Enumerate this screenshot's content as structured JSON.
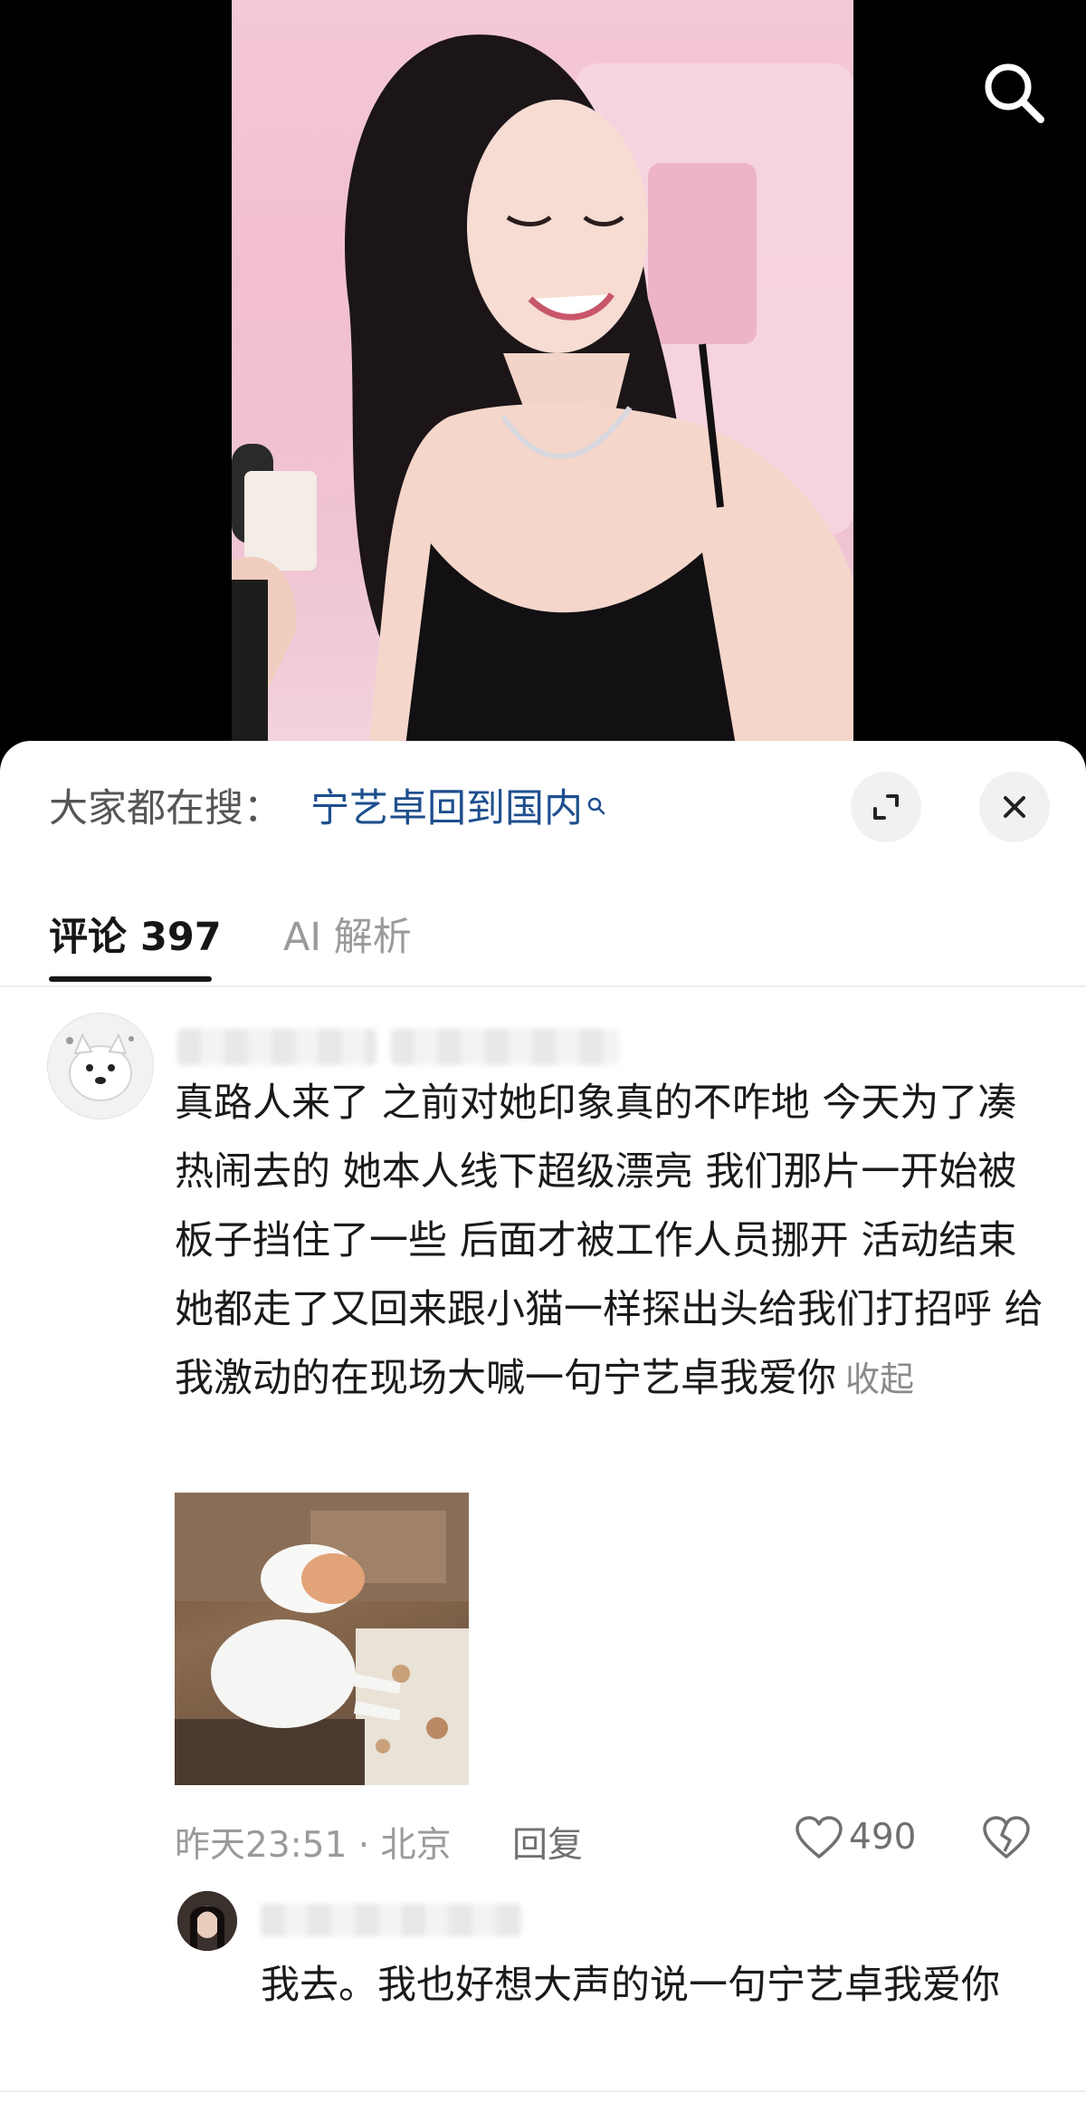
{
  "hot_search": {
    "label": "大家都在搜：",
    "term": "宁艺卓回到国内"
  },
  "tabs": [
    {
      "label": "评论 397",
      "active": true
    },
    {
      "label": "AI 解析",
      "active": false
    }
  ],
  "comment": {
    "text": "真路人来了 之前对她印象真的不咋地 今天为了凑热闹去的 她本人线下超级漂亮 我们那片一开始被板子挡住了一些 后面才被工作人员挪开 活动结束她都走了又回来跟小猫一样探出头给我们打招呼 给我激动的在现场大喊一句宁艺卓我爱你",
    "collapse_label": "收起",
    "time_location": "昨天23:51 · 北京",
    "reply_label": "回复",
    "like_count": "490"
  },
  "reply": {
    "text": "我去。我也好想大声的说一句宁艺卓我爱你"
  },
  "colors": {
    "link_blue": "#1e4f8e",
    "text_primary": "#1a1a1a",
    "text_muted": "#9a9a9a"
  }
}
